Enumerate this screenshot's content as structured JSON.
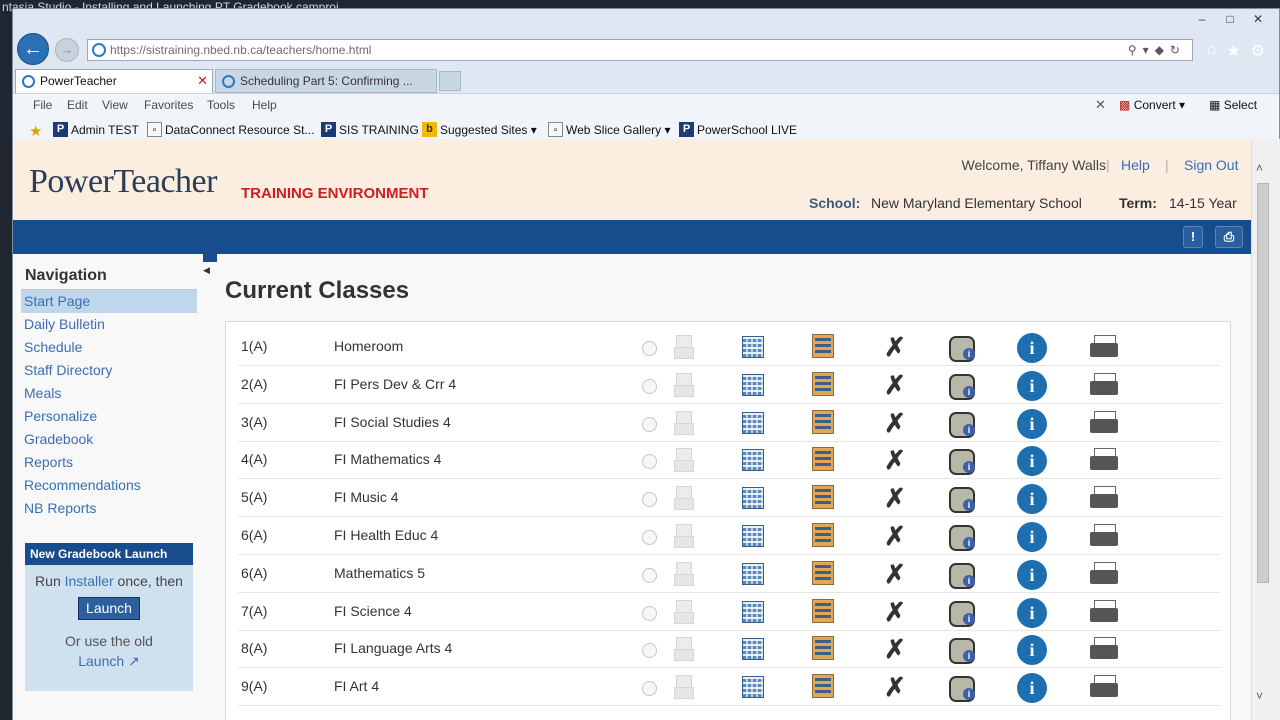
{
  "window_title": "ntasia Studio - Installing and Launching PT Gradebook.camproj",
  "browser": {
    "url": "https://sistraining.nbed.nb.ca/teachers/home.html",
    "tabs": [
      {
        "label": "PowerTeacher",
        "active": true
      },
      {
        "label": "Scheduling Part 5: Confirming ...",
        "active": false
      }
    ],
    "menu": [
      "File",
      "Edit",
      "View",
      "Favorites",
      "Tools",
      "Help"
    ],
    "menu_right": {
      "convert": "Convert",
      "select": "Select"
    },
    "favorites": [
      {
        "label": "Admin TEST",
        "icon": "P"
      },
      {
        "label": "DataConnect Resource St...",
        "icon": "doc"
      },
      {
        "label": "SIS TRAINING",
        "icon": "P"
      },
      {
        "label": "Suggested Sites ▾",
        "icon": "b"
      },
      {
        "label": "Web Slice Gallery ▾",
        "icon": "doc"
      },
      {
        "label": "PowerSchool LIVE",
        "icon": "P"
      }
    ]
  },
  "header": {
    "logo": "PowerTeacher",
    "environment": "TRAINING ENVIRONMENT",
    "welcome": "Welcome, Tiffany Walls",
    "help": "Help",
    "sign_out": "Sign Out",
    "school_label": "School:",
    "school": "New Maryland Elementary School",
    "term_label": "Term:",
    "term": "14-15 Year"
  },
  "navigation": {
    "title": "Navigation",
    "items": [
      {
        "label": "Start Page",
        "selected": true
      },
      {
        "label": "Daily Bulletin"
      },
      {
        "label": "Schedule"
      },
      {
        "label": "Staff Directory"
      },
      {
        "label": "Meals"
      },
      {
        "label": "Personalize"
      },
      {
        "label": "Gradebook"
      },
      {
        "label": "Reports"
      },
      {
        "label": "Recommendations"
      },
      {
        "label": "NB Reports"
      }
    ]
  },
  "launch_box": {
    "title": "New Gradebook Launch",
    "line_prefix": "Run ",
    "installer_link": "Installer",
    "line_suffix": " once, then",
    "button": "Launch",
    "old_text": "Or use the old",
    "old_link": "Launch ↗"
  },
  "main": {
    "title": "Current Classes",
    "classes": [
      {
        "expression": "1(A)",
        "course": "Homeroom"
      },
      {
        "expression": "2(A)",
        "course": "FI Pers Dev & Crr 4"
      },
      {
        "expression": "3(A)",
        "course": "FI Social Studies 4"
      },
      {
        "expression": "4(A)",
        "course": "FI Mathematics 4"
      },
      {
        "expression": "5(A)",
        "course": "FI Music 4"
      },
      {
        "expression": "6(A)",
        "course": "FI Health Educ 4"
      },
      {
        "expression": "6(A)",
        "course": "Mathematics 5"
      },
      {
        "expression": "7(A)",
        "course": "FI Science 4"
      },
      {
        "expression": "8(A)",
        "course": "FI Language Arts 4"
      },
      {
        "expression": "9(A)",
        "course": "FI Art 4"
      }
    ]
  }
}
